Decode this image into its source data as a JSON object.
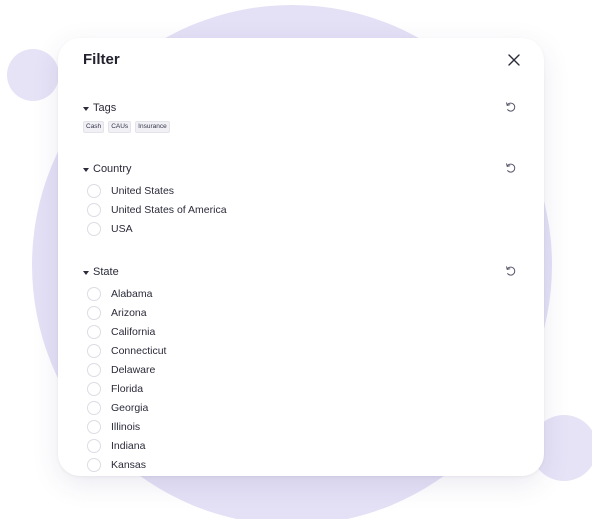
{
  "filter": {
    "title": "Filter",
    "close_icon": "close-icon",
    "reset_icon": "rotate-ccw-icon",
    "sections": {
      "tags": {
        "label": "Tags",
        "items": [
          "Cash",
          "CAUs",
          "Insurance"
        ]
      },
      "country": {
        "label": "Country",
        "options": [
          "United States",
          "United States of America",
          "USA"
        ]
      },
      "state": {
        "label": "State",
        "options": [
          "Alabama",
          "Arizona",
          "California",
          "Connecticut",
          "Delaware",
          "Florida",
          "Georgia",
          "Illinois",
          "Indiana",
          "Kansas"
        ]
      }
    }
  },
  "colors": {
    "background_blob": "#e4e1f6",
    "text": "#2b2b3a"
  }
}
